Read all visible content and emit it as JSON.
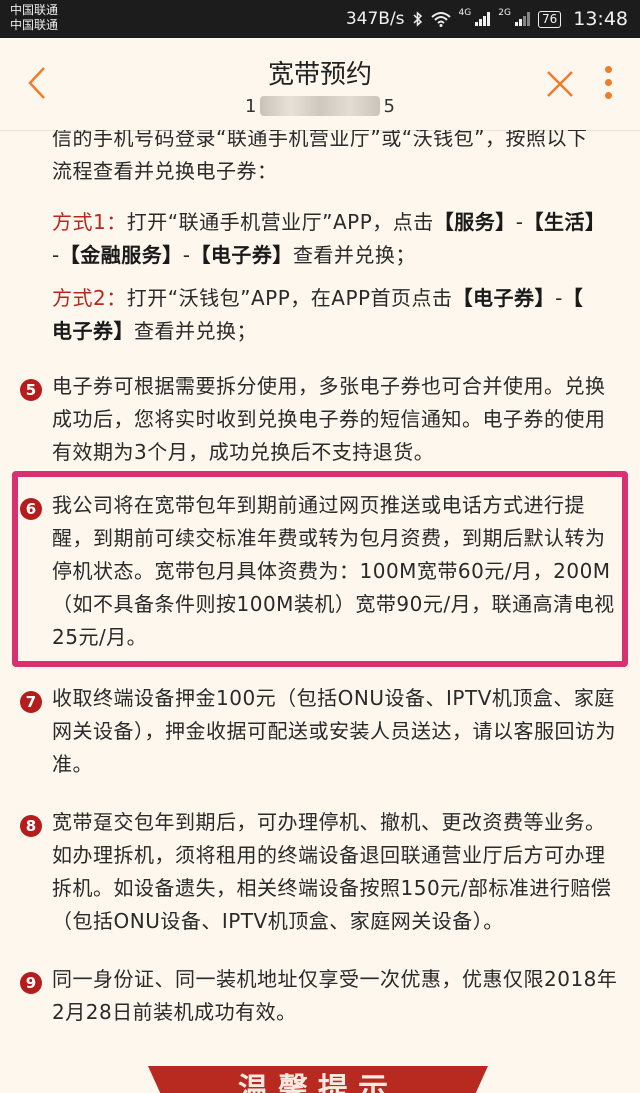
{
  "status_bar": {
    "carrier1": "中国联通",
    "carrier2": "中国联通",
    "speed": "347B/s",
    "net1": "4G",
    "net2": "2G",
    "battery": "76",
    "time": "13:48"
  },
  "nav": {
    "title": "宽带预约",
    "subtitle_lead": "1",
    "subtitle_tail": "5",
    "accent_color": "#f07d2a"
  },
  "content": {
    "intro_line1": "信的手机号码登录“联通手机营业厅”或“沃钱包”，按照以下",
    "intro_line2": "流程查看并兑换电子券：",
    "way1_label": "方式1：",
    "way1_text": "打开“联通手机营业厅”APP，点击",
    "way1_b1": "【服务】",
    "way1_b2": "【生活】",
    "way1_b3": "【金融服务】",
    "way1_b4": "【电子券】",
    "way1_tail": "查看并兑换；",
    "dash": "-",
    "way2_label": "方式2：",
    "way2_text": "打开“沃钱包”APP，在APP首页点击",
    "way2_b1": "【电子券】",
    "way2_b2a": "【",
    "way2_b2b": "电子券】",
    "way2_tail": "查看并兑换；",
    "items": [
      {
        "num": "5",
        "text": "电子券可根据需要拆分使用，多张电子券也可合并使用。兑换成功后，您将实时收到兑换电子券的短信通知。电子券的使用有效期为3个月，成功兑换后不支持退货。"
      },
      {
        "num": "6",
        "text": "我公司将在宽带包年到期前通过网页推送或电话方式进行提醒，到期前可续交标准年费或转为包月资费，到期后默认转为停机状态。宽带包月具体资费为：100M宽带60元/月，200M（如不具备条件则按100M装机）宽带90元/月，联通高清电视25元/月。"
      },
      {
        "num": "7",
        "text": "收取终端设备押金100元（包括ONU设备、IPTV机顶盒、家庭网关设备），押金收据可配送或安装人员送达，请以客服回访为准。"
      },
      {
        "num": "8",
        "text": "宽带趸交包年到期后，可办理停机、撤机、更改资费等业务。如办理拆机，须将租用的终端设备退回联通营业厅后方可办理拆机。如设备遗失，相关终端设备按照150元/部标准进行赔偿（包括ONU设备、IPTV机顶盒、家庭网关设备）。"
      },
      {
        "num": "9",
        "text": "同一身份证、同一装机地址仅享受一次优惠，优惠仅限2018年2月28日前装机成功有效。"
      }
    ],
    "banner": "温馨提示",
    "highlight_color": "#d9306f"
  }
}
